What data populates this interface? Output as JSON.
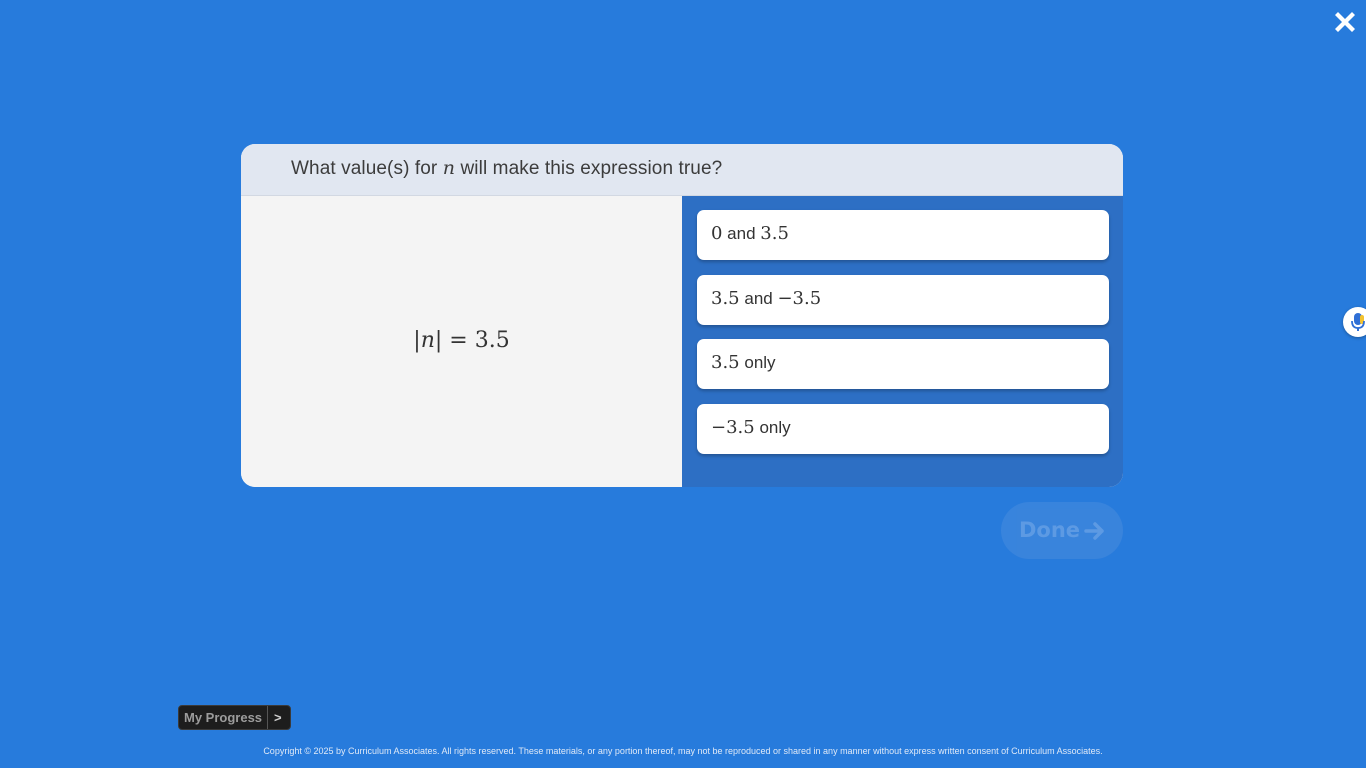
{
  "window": {
    "close_icon": "close-x-icon",
    "mic_icon": "microphone-icon"
  },
  "question": {
    "prompt_before": "What value(s) for",
    "prompt_variable": "n",
    "prompt_after": "will make this expression true?",
    "expression": {
      "abs_open": "|",
      "variable": "n",
      "abs_close": "|",
      "equals": " = ",
      "value": "3.5"
    }
  },
  "choices": [
    {
      "math_a": "0",
      "connector": " and ",
      "math_b": "3.5",
      "suffix": ""
    },
    {
      "math_a": "3.5",
      "connector": " and ",
      "math_b": "−3.5",
      "suffix": ""
    },
    {
      "math_a": "3.5",
      "connector": "",
      "math_b": "",
      "suffix": " only"
    },
    {
      "math_a": "−3.5",
      "connector": "",
      "math_b": "",
      "suffix": " only"
    }
  ],
  "done_button": {
    "label": "Done",
    "icon": "arrow-right-icon",
    "enabled": false
  },
  "footer": {
    "progress_label": "My Progress",
    "progress_chevron": ">",
    "copyright": "Copyright © 2025 by Curriculum Associates. All rights reserved. These materials, or any portion thereof, may not be reproduced or shared in any manner without express written consent of Curriculum Associates."
  },
  "colors": {
    "background": "#277bdc",
    "header": "#e1e7f1",
    "choices_panel": "#2d6fc4",
    "done_button": "#3f87dd"
  }
}
